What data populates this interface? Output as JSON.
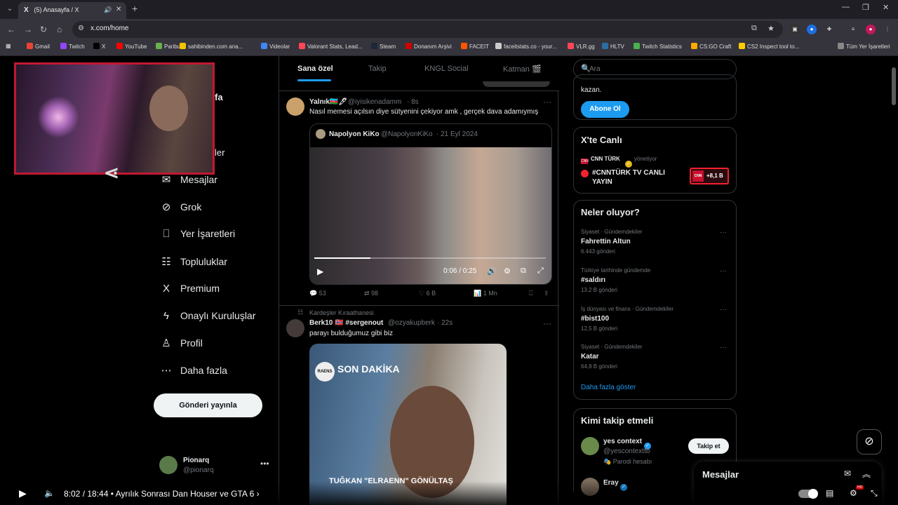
{
  "browser": {
    "tab_title": "(5) Anasayfa / X",
    "tab_favicon": "X",
    "url": "x.com/home",
    "bookmarks": [
      {
        "label": "Gmail",
        "color": "#ea4335"
      },
      {
        "label": "Twitch",
        "color": "#9146ff"
      },
      {
        "label": "X",
        "color": "#000000"
      },
      {
        "label": "YouTube",
        "color": "#ff0000"
      },
      {
        "label": "Paribu",
        "color": "#6ab04c"
      },
      {
        "label": "sahibinden.com ana...",
        "color": "#f4c300"
      },
      {
        "label": "Videolar",
        "color": "#4285f4"
      },
      {
        "label": "Valorant Stats, Lead...",
        "color": "#ff4655"
      },
      {
        "label": "Steam",
        "color": "#1b2838"
      },
      {
        "label": "Donanım Arşivi",
        "color": "#d00000"
      },
      {
        "label": "FACEIT",
        "color": "#ff5500"
      },
      {
        "label": "faceitstats.co - your...",
        "color": "#cccccc"
      },
      {
        "label": "VLR.gg",
        "color": "#ff4655"
      },
      {
        "label": "HLTV",
        "color": "#2b6ea4"
      },
      {
        "label": "Twitch Statistics",
        "color": "#4caf50"
      },
      {
        "label": "CS:GO Craft",
        "color": "#ffaa00"
      },
      {
        "label": "CS2 Inspect tool to...",
        "color": "#ffcc00"
      },
      {
        "label": "Tüm Yer İşaretleri",
        "color": "#888888"
      }
    ]
  },
  "webcam_text": "fa",
  "webcam_partial_text": "ler",
  "left_nav": [
    {
      "label": "Mesajlar",
      "icon": "mail-icon",
      "glyph": "✉"
    },
    {
      "label": "Grok",
      "icon": "grok-icon",
      "glyph": "⊘"
    },
    {
      "label": "Yer İşaretleri",
      "icon": "bookmark-icon",
      "glyph": "⎕"
    },
    {
      "label": "Topluluklar",
      "icon": "communities-icon",
      "glyph": "☷"
    },
    {
      "label": "Premium",
      "icon": "x-logo-icon",
      "glyph": "X"
    },
    {
      "label": "Onaylı Kuruluşlar",
      "icon": "lightning-icon",
      "glyph": "ϟ"
    },
    {
      "label": "Profil",
      "icon": "profile-icon",
      "glyph": "♙"
    },
    {
      "label": "Daha fazla",
      "icon": "more-circle-icon",
      "glyph": "⋯"
    }
  ],
  "post_button": "Gönderi yayınla",
  "account": {
    "name": "Pionarq",
    "handle": "@pionarq"
  },
  "feed_tabs": [
    "Sana özel",
    "Takip",
    "KNGL Social",
    "Katman 🎬"
  ],
  "posts": [
    {
      "name": "Yalnık🇦🇿🖊",
      "handle": "@iyisikenadamm",
      "time": "· 8s",
      "text": "Nasıl memesi açılsın diye sütyenini çekiyor amk   , gerçek dava adamıymış",
      "quote": {
        "name": "Napolyon KiKo",
        "handle": "@NapolyonKiKo",
        "time": "· 21 Eyl 2024"
      },
      "video_time": "0:06 / 0:25",
      "actions": {
        "replies": "53",
        "reposts": "98",
        "likes": "6 B",
        "views": "1 Mn"
      }
    },
    {
      "context": "Kardeşler Kıraathanesi",
      "name": "Berk10 🇳🇴 #sergenout",
      "handle": "@ozyakupberk",
      "time": "· 22s",
      "text": "parayı bulduğumuz gibi biz",
      "image_headline": "SON DAKİKA",
      "image_badge": "RAENS",
      "image_caption": "TUĞKAN \"ELRAENN\" GÖNÜLTAŞ"
    }
  ],
  "search_placeholder": "Ara",
  "premium_card": {
    "text": "kazan.",
    "button": "Abone Ol"
  },
  "live_card": {
    "title": "X'te Canlı",
    "channel": "CNN TÜRK",
    "status": "yönetiyor",
    "stream_title": "#CNNTÜRK TV CANLI YAYIN",
    "viewers": "+8,1 B",
    "badge": "CNN"
  },
  "trends": {
    "title": "Neler oluyor?",
    "items": [
      {
        "category": "Siyaset · Gündemdekiler",
        "name": "Fahrettin Altun",
        "count": "6.443 gönderi"
      },
      {
        "category": "Türkiye tarihinde gündemde",
        "name": "#saldırı",
        "count": "13,2 B gönderi"
      },
      {
        "category": "İş dünyası ve finans · Gündemdekiler",
        "name": "#bist100",
        "count": "12,5 B gönderi"
      },
      {
        "category": "Siyaset · Gündemdekiler",
        "name": "Katar",
        "count": "64,8 B gönderi"
      }
    ],
    "more": "Daha fazla göster"
  },
  "who_to_follow": {
    "title": "Kimi takip etmeli",
    "items": [
      {
        "name": "yes context",
        "handle": "@yescontextfb",
        "note": "Parodi hesabı",
        "button": "Takip et"
      },
      {
        "name": "Eray"
      }
    ]
  },
  "messages_drawer": "Mesajlar",
  "youtube": {
    "time": "8:02 / 18:44",
    "title": "• Ayrılık Sonrası Dan Houser ve GTA 6 ›",
    "hd": "HD"
  }
}
